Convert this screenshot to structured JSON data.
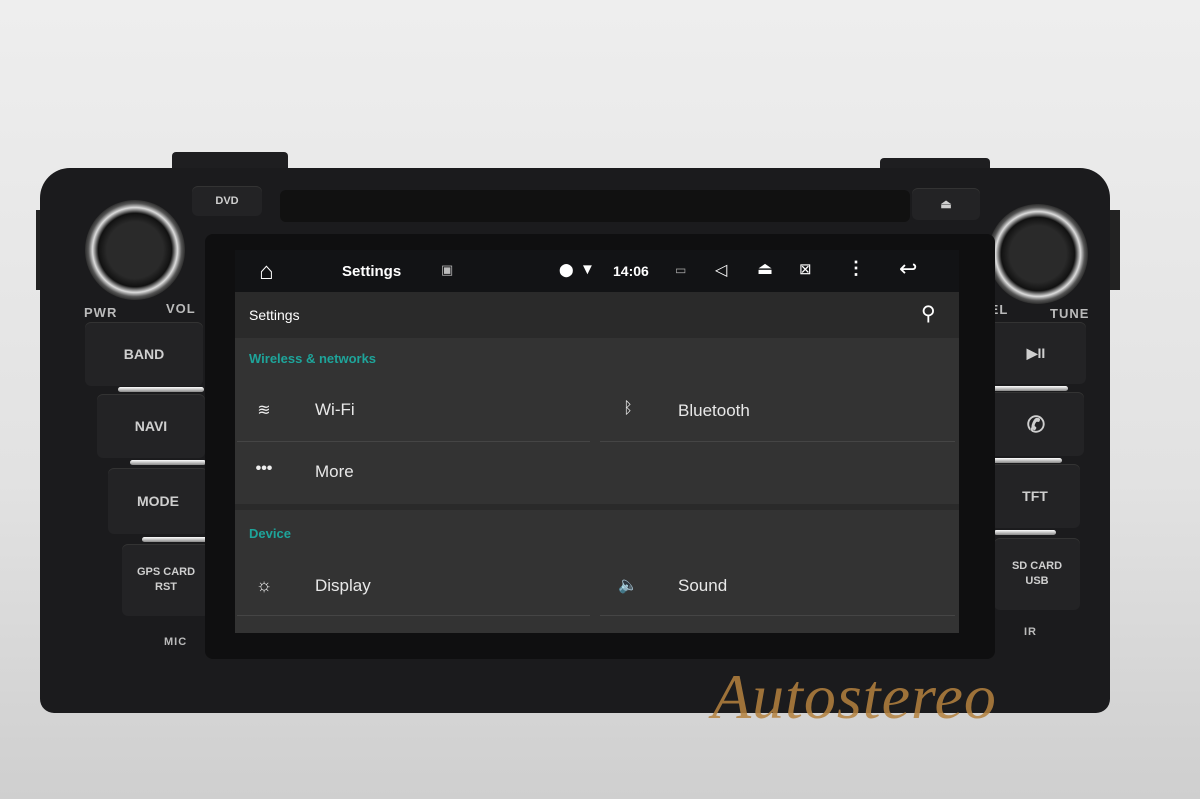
{
  "device": {
    "top_buttons": {
      "dvd": "DVD",
      "eject_icon": "eject-icon"
    },
    "left_knob": {
      "left_label": "PWR",
      "right_label": "VOL"
    },
    "right_knob": {
      "left_label": "SEL",
      "right_label": "TUNE"
    },
    "left_buttons": [
      "BAND",
      "NAVI",
      "MODE",
      "GPS CARD\nRST"
    ],
    "left_mic": "MIC",
    "right_buttons": [
      {
        "icon": "play-pause-icon",
        "glyph": "▶II"
      },
      {
        "icon": "phone-icon",
        "glyph": "✆"
      },
      {
        "label": "TFT"
      },
      {
        "label": "SD CARD\nUSB"
      }
    ],
    "right_ir": "IR"
  },
  "status_bar": {
    "title": "Settings",
    "time": "14:06",
    "icons": [
      "home-icon",
      "image-icon",
      "location-icon",
      "wifi-icon",
      "battery-icon",
      "volume-icon",
      "eject-icon",
      "close-window-icon",
      "menu-dots-icon",
      "back-icon"
    ]
  },
  "header": {
    "title": "Settings",
    "search_icon": "search-icon"
  },
  "sections": [
    {
      "title": "Wireless & networks",
      "items": [
        {
          "label": "Wi-Fi",
          "icon": "wifi-icon"
        },
        {
          "label": "Bluetooth",
          "icon": "bluetooth-icon"
        },
        {
          "label": "More",
          "icon": "more-icon"
        }
      ]
    },
    {
      "title": "Device",
      "items": [
        {
          "label": "Display",
          "icon": "brightness-icon"
        },
        {
          "label": "Sound",
          "icon": "sound-icon"
        }
      ]
    }
  ],
  "colors": {
    "accent": "#1ea49a",
    "logo": "#b5823f"
  },
  "watermark": "Autostereo"
}
